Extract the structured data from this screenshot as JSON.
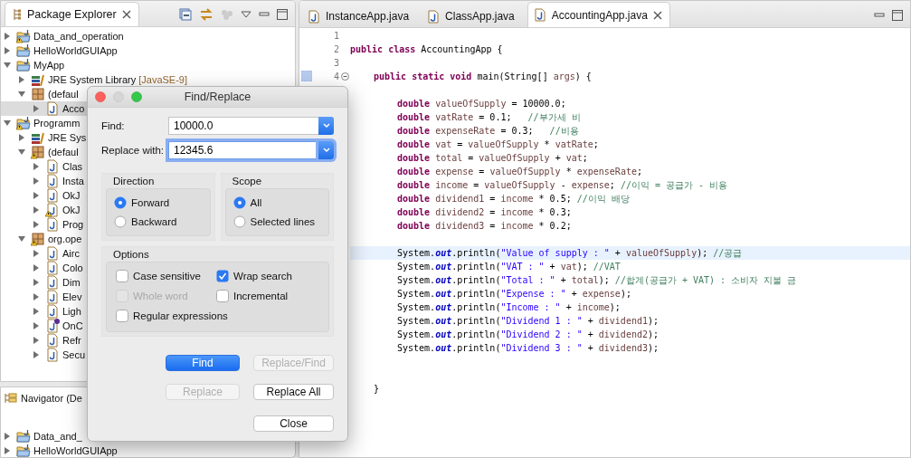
{
  "explorer": {
    "title": "Package Explorer",
    "tree": [
      {
        "label": "Data_and_operation",
        "kind": "project",
        "warning": true,
        "expanded": false,
        "selected": false
      },
      {
        "label": "HelloWorldGUIApp",
        "kind": "project",
        "warning": false,
        "expanded": false,
        "selected": false
      },
      {
        "label": "MyApp",
        "kind": "project",
        "warning": false,
        "expanded": true,
        "selected": false,
        "children": [
          {
            "label": "JRE System Library",
            "decoration": "[JavaSE-9]",
            "kind": "library",
            "warning": false,
            "expanded": false,
            "selected": false
          },
          {
            "label": "(defaul",
            "kind": "package",
            "warning": false,
            "expanded": true,
            "selected": false,
            "children": [
              {
                "label": "Acco",
                "kind": "source",
                "warning": false,
                "expanded": false,
                "selected": true
              }
            ]
          }
        ]
      },
      {
        "label": "Programm",
        "kind": "project",
        "warning": true,
        "expanded": true,
        "selected": false,
        "children": [
          {
            "label": "JRE Sys",
            "kind": "library",
            "warning": false,
            "expanded": false,
            "selected": false
          },
          {
            "label": "(defaul",
            "kind": "package",
            "warning": true,
            "expanded": true,
            "selected": false,
            "children": [
              {
                "label": "Clas",
                "kind": "source",
                "warning": false,
                "expanded": false,
                "selected": false
              },
              {
                "label": "Insta",
                "kind": "source",
                "warning": false,
                "expanded": false,
                "selected": false
              },
              {
                "label": "OkJ",
                "kind": "source",
                "warning": false,
                "expanded": false,
                "selected": false
              },
              {
                "label": "OkJ",
                "kind": "source",
                "warning": true,
                "expanded": false,
                "selected": false
              },
              {
                "label": "Prog",
                "kind": "source",
                "warning": false,
                "expanded": false,
                "selected": false
              }
            ]
          },
          {
            "label": "org.ope",
            "kind": "package",
            "warning": true,
            "expanded": true,
            "selected": false,
            "children": [
              {
                "label": "Airc",
                "kind": "source",
                "warning": false,
                "expanded": false,
                "selected": false
              },
              {
                "label": "Colo",
                "kind": "source",
                "warning": false,
                "expanded": false,
                "selected": false
              },
              {
                "label": "Dim",
                "kind": "source",
                "warning": false,
                "expanded": false,
                "selected": false
              },
              {
                "label": "Elev",
                "kind": "source",
                "warning": false,
                "expanded": false,
                "selected": false
              },
              {
                "label": "Ligh",
                "kind": "source",
                "warning": false,
                "expanded": false,
                "selected": false
              },
              {
                "label": "OnC",
                "kind": "interface",
                "warning": false,
                "expanded": false,
                "selected": false
              },
              {
                "label": "Refr",
                "kind": "source",
                "warning": false,
                "expanded": false,
                "selected": false
              },
              {
                "label": "Secu",
                "kind": "source",
                "warning": false,
                "expanded": false,
                "selected": false
              }
            ]
          }
        ]
      }
    ]
  },
  "navigator": {
    "title": "Navigator (De",
    "tree": [
      {
        "label": "Data_and_",
        "kind": "project",
        "warning": false,
        "expanded": false,
        "selected": false
      },
      {
        "label": "HelloWorldGUIApp",
        "kind": "project",
        "warning": false,
        "expanded": false,
        "selected": false
      }
    ]
  },
  "editor": {
    "tabs": [
      {
        "label": "InstanceApp.java",
        "selected": false
      },
      {
        "label": "ClassApp.java",
        "selected": false
      },
      {
        "label": "AccountingApp.java",
        "selected": true
      }
    ],
    "lines": [
      {
        "number": "1",
        "fold": false,
        "marker": false,
        "current": false
      },
      {
        "number": "2",
        "fold": false,
        "marker": false,
        "current": false,
        "tokens": [
          {
            "kind": "keyword",
            "text": "public class"
          },
          {
            "kind": "plain",
            "text": " AccountingApp {"
          }
        ],
        "children": [
          {
            "number": "3",
            "fold": false,
            "marker": false,
            "current": false
          },
          {
            "number": "4",
            "fold": true,
            "marker": true,
            "current": false,
            "tokens": [
              {
                "kind": "keyword",
                "text": "public static void"
              },
              {
                "kind": "plain",
                "text": " main(String[] "
              },
              {
                "kind": "variable",
                "text": "args"
              },
              {
                "kind": "plain",
                "text": ") {"
              }
            ],
            "children": [
              {
                "fold": false,
                "marker": false,
                "current": false
              },
              {
                "fold": false,
                "marker": false,
                "current": false,
                "tokens": [
                  {
                    "kind": "keyword",
                    "text": "double "
                  },
                  {
                    "kind": "variable",
                    "text": "valueOfSupply"
                  },
                  {
                    "kind": "plain",
                    "text": " = 10000.0;"
                  }
                ]
              },
              {
                "fold": false,
                "marker": false,
                "current": false,
                "tokens": [
                  {
                    "kind": "keyword",
                    "text": "double "
                  },
                  {
                    "kind": "variable",
                    "text": "vatRate"
                  },
                  {
                    "kind": "plain",
                    "text": " = 0.1;   "
                  },
                  {
                    "kind": "comment",
                    "text": "//부가세 비"
                  }
                ]
              },
              {
                "fold": false,
                "marker": false,
                "current": false,
                "tokens": [
                  {
                    "kind": "keyword",
                    "text": "double "
                  },
                  {
                    "kind": "variable",
                    "text": "expenseRate"
                  },
                  {
                    "kind": "plain",
                    "text": " = 0.3;   "
                  },
                  {
                    "kind": "comment",
                    "text": "//비용"
                  }
                ]
              },
              {
                "fold": false,
                "marker": false,
                "current": false,
                "tokens": [
                  {
                    "kind": "keyword",
                    "text": "double "
                  },
                  {
                    "kind": "variable",
                    "text": "vat"
                  },
                  {
                    "kind": "plain",
                    "text": " = "
                  },
                  {
                    "kind": "variable",
                    "text": "valueOfSupply"
                  },
                  {
                    "kind": "plain",
                    "text": " * "
                  },
                  {
                    "kind": "variable",
                    "text": "vatRate"
                  },
                  {
                    "kind": "plain",
                    "text": ";"
                  }
                ]
              },
              {
                "fold": false,
                "marker": false,
                "current": false,
                "tokens": [
                  {
                    "kind": "keyword",
                    "text": "double "
                  },
                  {
                    "kind": "variable",
                    "text": "total"
                  },
                  {
                    "kind": "plain",
                    "text": " = "
                  },
                  {
                    "kind": "variable",
                    "text": "valueOfSupply"
                  },
                  {
                    "kind": "plain",
                    "text": " + "
                  },
                  {
                    "kind": "variable",
                    "text": "vat"
                  },
                  {
                    "kind": "plain",
                    "text": ";"
                  }
                ]
              },
              {
                "fold": false,
                "marker": false,
                "current": false,
                "tokens": [
                  {
                    "kind": "keyword",
                    "text": "double "
                  },
                  {
                    "kind": "variable",
                    "text": "expense"
                  },
                  {
                    "kind": "plain",
                    "text": " = "
                  },
                  {
                    "kind": "variable",
                    "text": "valueOfSupply"
                  },
                  {
                    "kind": "plain",
                    "text": " * "
                  },
                  {
                    "kind": "variable",
                    "text": "expenseRate"
                  },
                  {
                    "kind": "plain",
                    "text": ";"
                  }
                ]
              },
              {
                "fold": false,
                "marker": false,
                "current": false,
                "tokens": [
                  {
                    "kind": "keyword",
                    "text": "double "
                  },
                  {
                    "kind": "variable",
                    "text": "income"
                  },
                  {
                    "kind": "plain",
                    "text": " = "
                  },
                  {
                    "kind": "variable",
                    "text": "valueOfSupply"
                  },
                  {
                    "kind": "plain",
                    "text": " - "
                  },
                  {
                    "kind": "variable",
                    "text": "expense"
                  },
                  {
                    "kind": "plain",
                    "text": "; "
                  },
                  {
                    "kind": "comment",
                    "text": "//이익 = 공급가 - 비용"
                  }
                ]
              },
              {
                "fold": false,
                "marker": false,
                "current": false,
                "tokens": [
                  {
                    "kind": "keyword",
                    "text": "double "
                  },
                  {
                    "kind": "variable",
                    "text": "dividend1"
                  },
                  {
                    "kind": "plain",
                    "text": " = "
                  },
                  {
                    "kind": "variable",
                    "text": "income"
                  },
                  {
                    "kind": "plain",
                    "text": " * 0.5; "
                  },
                  {
                    "kind": "comment",
                    "text": "//이익 배당"
                  }
                ]
              },
              {
                "fold": false,
                "marker": false,
                "current": false,
                "tokens": [
                  {
                    "kind": "keyword",
                    "text": "double "
                  },
                  {
                    "kind": "variable",
                    "text": "dividend2"
                  },
                  {
                    "kind": "plain",
                    "text": " = "
                  },
                  {
                    "kind": "variable",
                    "text": "income"
                  },
                  {
                    "kind": "plain",
                    "text": " * 0.3;"
                  }
                ]
              },
              {
                "fold": false,
                "marker": false,
                "current": false,
                "tokens": [
                  {
                    "kind": "keyword",
                    "text": "double "
                  },
                  {
                    "kind": "variable",
                    "text": "dividend3"
                  },
                  {
                    "kind": "plain",
                    "text": " = "
                  },
                  {
                    "kind": "variable",
                    "text": "income"
                  },
                  {
                    "kind": "plain",
                    "text": " * 0.2;"
                  }
                ]
              },
              {
                "fold": false,
                "marker": false,
                "current": false
              },
              {
                "fold": false,
                "marker": false,
                "current": true,
                "tokens": [
                  {
                    "kind": "plain",
                    "text": "System."
                  },
                  {
                    "kind": "field",
                    "text": "out"
                  },
                  {
                    "kind": "plain",
                    "text": ".println("
                  },
                  {
                    "kind": "string",
                    "text": "\"Value of supply : \""
                  },
                  {
                    "kind": "plain",
                    "text": " + "
                  },
                  {
                    "kind": "variable",
                    "text": "valueOfSupply"
                  },
                  {
                    "kind": "plain",
                    "text": "); "
                  },
                  {
                    "kind": "comment",
                    "text": "//공급"
                  }
                ]
              },
              {
                "fold": false,
                "marker": false,
                "current": false,
                "tokens": [
                  {
                    "kind": "plain",
                    "text": "System."
                  },
                  {
                    "kind": "field",
                    "text": "out"
                  },
                  {
                    "kind": "plain",
                    "text": ".println("
                  },
                  {
                    "kind": "string",
                    "text": "\"VAT : \""
                  },
                  {
                    "kind": "plain",
                    "text": " + "
                  },
                  {
                    "kind": "variable",
                    "text": "vat"
                  },
                  {
                    "kind": "plain",
                    "text": "); "
                  },
                  {
                    "kind": "comment",
                    "text": "//VAT"
                  }
                ]
              },
              {
                "fold": false,
                "marker": false,
                "current": false,
                "tokens": [
                  {
                    "kind": "plain",
                    "text": "System."
                  },
                  {
                    "kind": "field",
                    "text": "out"
                  },
                  {
                    "kind": "plain",
                    "text": ".println("
                  },
                  {
                    "kind": "string",
                    "text": "\"Total : \""
                  },
                  {
                    "kind": "plain",
                    "text": " + "
                  },
                  {
                    "kind": "variable",
                    "text": "total"
                  },
                  {
                    "kind": "plain",
                    "text": "); "
                  },
                  {
                    "kind": "comment",
                    "text": "//합계(공급가 + VAT) : 소비자 지불 금"
                  }
                ]
              },
              {
                "fold": false,
                "marker": false,
                "current": false,
                "tokens": [
                  {
                    "kind": "plain",
                    "text": "System."
                  },
                  {
                    "kind": "field",
                    "text": "out"
                  },
                  {
                    "kind": "plain",
                    "text": ".println("
                  },
                  {
                    "kind": "string",
                    "text": "\"Expense : \""
                  },
                  {
                    "kind": "plain",
                    "text": " + "
                  },
                  {
                    "kind": "variable",
                    "text": "expense"
                  },
                  {
                    "kind": "plain",
                    "text": ");"
                  }
                ]
              },
              {
                "fold": false,
                "marker": false,
                "current": false,
                "tokens": [
                  {
                    "kind": "plain",
                    "text": "System."
                  },
                  {
                    "kind": "field",
                    "text": "out"
                  },
                  {
                    "kind": "plain",
                    "text": ".println("
                  },
                  {
                    "kind": "string",
                    "text": "\"Income : \""
                  },
                  {
                    "kind": "plain",
                    "text": " + "
                  },
                  {
                    "kind": "variable",
                    "text": "income"
                  },
                  {
                    "kind": "plain",
                    "text": ");"
                  }
                ]
              },
              {
                "fold": false,
                "marker": false,
                "current": false,
                "tokens": [
                  {
                    "kind": "plain",
                    "text": "System."
                  },
                  {
                    "kind": "field",
                    "text": "out"
                  },
                  {
                    "kind": "plain",
                    "text": ".println("
                  },
                  {
                    "kind": "string",
                    "text": "\"Dividend 1 : \""
                  },
                  {
                    "kind": "plain",
                    "text": " + "
                  },
                  {
                    "kind": "variable",
                    "text": "dividend1"
                  },
                  {
                    "kind": "plain",
                    "text": ");"
                  }
                ]
              },
              {
                "fold": false,
                "marker": false,
                "current": false,
                "tokens": [
                  {
                    "kind": "plain",
                    "text": "System."
                  },
                  {
                    "kind": "field",
                    "text": "out"
                  },
                  {
                    "kind": "plain",
                    "text": ".println("
                  },
                  {
                    "kind": "string",
                    "text": "\"Dividend 2 : \""
                  },
                  {
                    "kind": "plain",
                    "text": " + "
                  },
                  {
                    "kind": "variable",
                    "text": "dividend2"
                  },
                  {
                    "kind": "plain",
                    "text": ");"
                  }
                ]
              },
              {
                "fold": false,
                "marker": false,
                "current": false,
                "tokens": [
                  {
                    "kind": "plain",
                    "text": "System."
                  },
                  {
                    "kind": "field",
                    "text": "out"
                  },
                  {
                    "kind": "plain",
                    "text": ".println("
                  },
                  {
                    "kind": "string",
                    "text": "\"Dividend 3 : \""
                  },
                  {
                    "kind": "plain",
                    "text": " + "
                  },
                  {
                    "kind": "variable",
                    "text": "dividend3"
                  },
                  {
                    "kind": "plain",
                    "text": ");"
                  }
                ]
              },
              {
                "fold": false,
                "marker": false,
                "current": false
              },
              {
                "fold": false,
                "marker": false,
                "current": false
              }
            ]
          },
          {
            "fold": false,
            "marker": false,
            "current": false,
            "tokens": [
              {
                "kind": "plain",
                "text": "}"
              }
            ]
          }
        ]
      }
    ]
  },
  "dialog": {
    "title": "Find/Replace",
    "fields": [
      {
        "label": "Find:",
        "value": "10000.0",
        "focused": false
      },
      {
        "label": "Replace with:",
        "value": "12345.6",
        "focused": true
      }
    ],
    "groups": [
      {
        "title": "Direction",
        "options": [
          {
            "label": "Forward",
            "selected": true
          },
          {
            "label": "Backward",
            "selected": false
          }
        ]
      },
      {
        "title": "Scope",
        "options": [
          {
            "label": "All",
            "selected": true
          },
          {
            "label": "Selected lines",
            "selected": false
          }
        ]
      }
    ],
    "options": {
      "title": "Options",
      "checkboxes": [
        {
          "label": "Case sensitive",
          "checked": false,
          "disabled": false
        },
        {
          "label": "Wrap search",
          "checked": true,
          "disabled": false
        },
        {
          "label": "Whole word",
          "checked": false,
          "disabled": true
        },
        {
          "label": "Incremental",
          "checked": false,
          "disabled": false
        },
        {
          "label": "Regular expressions",
          "checked": false,
          "disabled": false
        }
      ]
    },
    "buttons": [
      {
        "label": "Find",
        "default": true,
        "disabled": false
      },
      {
        "label": "Replace/Find",
        "default": false,
        "disabled": true
      },
      {
        "label": "Replace",
        "default": false,
        "disabled": true
      },
      {
        "label": "Replace All",
        "default": false,
        "disabled": false
      },
      {
        "label": "Close",
        "default": false,
        "disabled": false
      }
    ]
  }
}
